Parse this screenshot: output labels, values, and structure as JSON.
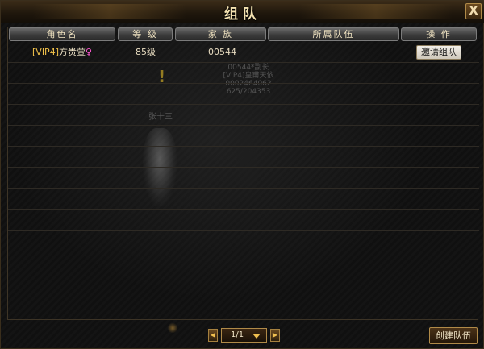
{
  "window": {
    "title": "组队",
    "close_label": "X"
  },
  "table": {
    "headers": [
      "角色名",
      "等 级",
      "家 族",
      "所属队伍",
      "操 作"
    ],
    "rows": [
      {
        "vip": "[VIP4]",
        "name": "方贵萱",
        "gender_symbol": "♀",
        "level": "85级",
        "family": "00544",
        "team": "",
        "action": "邀请组队"
      }
    ]
  },
  "background_text": {
    "lines": [
      "00544*副长",
      "[VIP4]皇甫天依",
      "0002464062",
      "625/204353"
    ],
    "name": "张十三",
    "exclaim": "!"
  },
  "pager": {
    "prev": "◀",
    "next": "▶",
    "page": "1/1"
  },
  "footer": {
    "create_team": "创建队伍"
  }
}
